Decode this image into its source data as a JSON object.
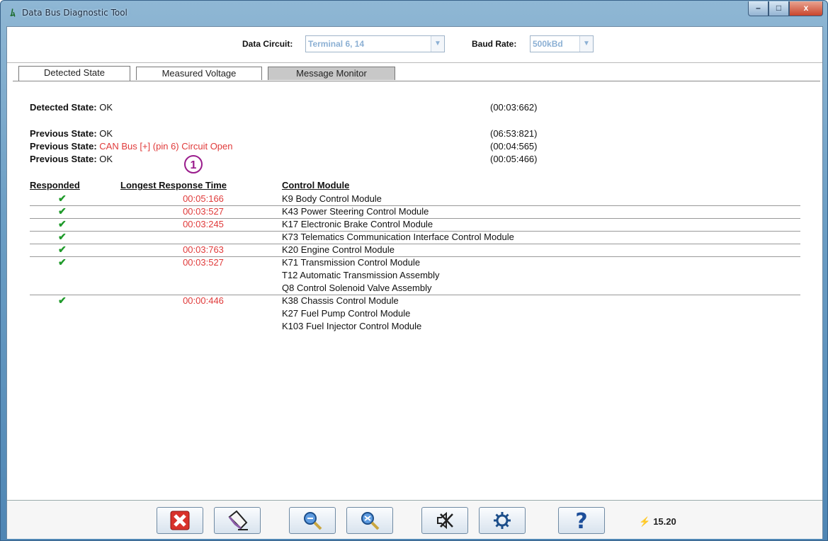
{
  "window": {
    "title": "Data Bus Diagnostic Tool",
    "controls": {
      "minimize": "–",
      "maximize": "□",
      "close": "x"
    }
  },
  "toolbar": {
    "data_circuit_label": "Data Circuit:",
    "data_circuit_value": "Terminal 6, 14",
    "baud_rate_label": "Baud Rate:",
    "baud_rate_value": "500kBd"
  },
  "tabs": [
    {
      "label": "Detected State",
      "active": true
    },
    {
      "label": "Measured Voltage",
      "active": false
    },
    {
      "label": "Message Monitor",
      "active": false
    }
  ],
  "states": [
    {
      "label": "Detected State:",
      "value": "OK",
      "time": "(00:03:662)",
      "color": "#111111"
    },
    {
      "label": "Previous State:",
      "value": "OK",
      "time": "(06:53:821)",
      "color": "#111111"
    },
    {
      "label": "Previous State:",
      "value": "CAN Bus [+] (pin 6) Circuit Open",
      "time": "(00:04:565)",
      "color": "#e03a3a"
    },
    {
      "label": "Previous State:",
      "value": "OK",
      "time": "(00:05:466)",
      "color": "#111111"
    }
  ],
  "callout": "1",
  "table": {
    "headers": {
      "responded": "Responded",
      "response_time": "Longest Response Time",
      "module": "Control Module"
    },
    "rows": [
      {
        "responded": "✔",
        "time": "00:05:166",
        "module": "K9 Body Control Module"
      },
      {
        "responded": "✔",
        "time": "00:03:527",
        "module": "K43 Power Steering Control Module"
      },
      {
        "responded": "✔",
        "time": "00:03:245",
        "module": "K17 Electronic Brake Control Module"
      },
      {
        "responded": "✔",
        "time": "",
        "module": "K73 Telematics Communication Interface Control Module"
      },
      {
        "responded": "✔",
        "time": "00:03:763",
        "module": "K20 Engine Control Module"
      },
      {
        "responded": "✔",
        "time": "00:03:527",
        "module": "K71 Transmission Control Module"
      },
      {
        "responded": "",
        "time": "",
        "module": "T12 Automatic Transmission Assembly"
      },
      {
        "responded": "",
        "time": "",
        "module": "Q8 Control Solenoid Valve Assembly"
      },
      {
        "responded": "✔",
        "time": "00:00:446",
        "module": "K38 Chassis Control Module"
      },
      {
        "responded": "",
        "time": "",
        "module": "K27 Fuel Pump Control Module"
      },
      {
        "responded": "",
        "time": "",
        "module": "K103 Fuel Injector Control Module"
      }
    ]
  },
  "bottom_toolbar": {
    "buttons": [
      {
        "name": "close-x-button",
        "icon": "close-x-icon"
      },
      {
        "name": "erase-button",
        "icon": "eraser-icon"
      },
      {
        "name": "zoom-in-button",
        "icon": "magnifier-plus-icon"
      },
      {
        "name": "zoom-out-button",
        "icon": "magnifier-minus-icon"
      },
      {
        "name": "mute-button",
        "icon": "speaker-mute-icon"
      },
      {
        "name": "settings-button",
        "icon": "gear-icon"
      },
      {
        "name": "help-button",
        "icon": "question-icon"
      }
    ],
    "voltage": "15.20"
  },
  "colors": {
    "accent": "#4f86b4",
    "error_text": "#e03a3a",
    "check": "#1f9a2a",
    "callout": "#9a1c8c"
  }
}
